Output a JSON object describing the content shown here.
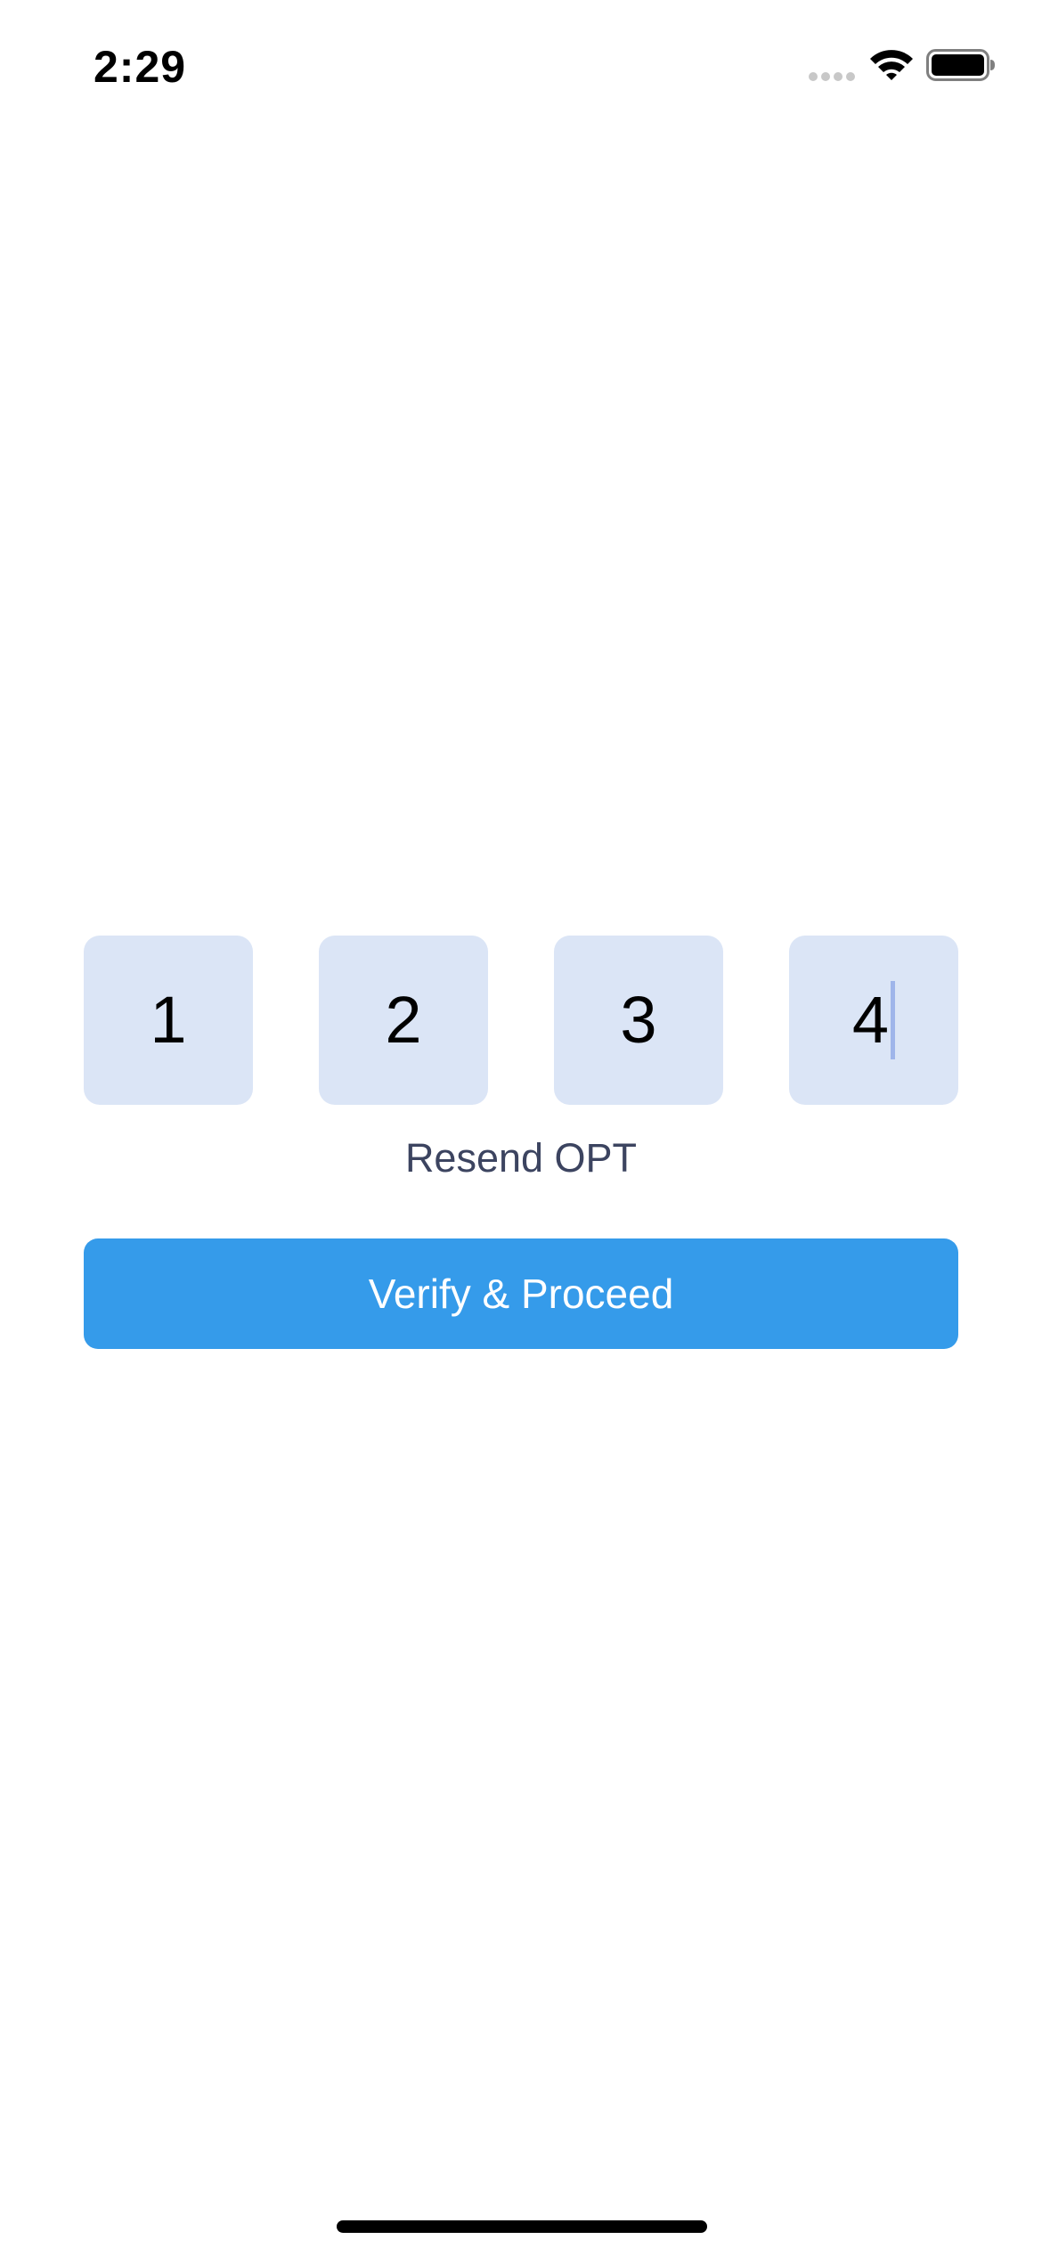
{
  "status_bar": {
    "time": "2:29"
  },
  "otp": {
    "digits": [
      "1",
      "2",
      "3",
      "4"
    ]
  },
  "resend": {
    "label": "Resend OPT"
  },
  "verify": {
    "label": "Verify & Proceed"
  },
  "colors": {
    "otp_box_background": "#dbe5f6",
    "primary_button": "#359bea",
    "resend_text": "#3c4460"
  },
  "icons": {
    "cellular": "cellular-signal-icon",
    "wifi": "wifi-icon",
    "battery": "battery-icon"
  }
}
